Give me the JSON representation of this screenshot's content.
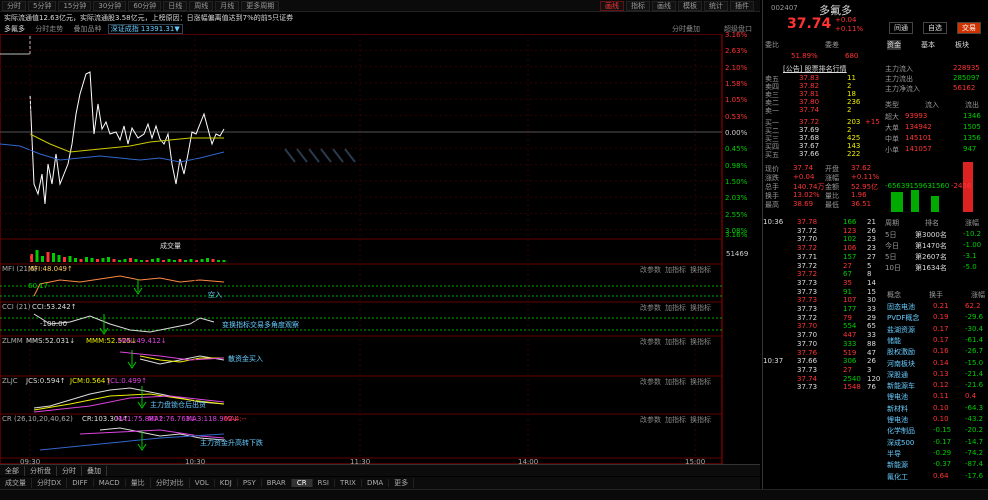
{
  "toolbar": {
    "left": [
      "分时",
      "5分钟",
      "15分钟",
      "30分钟",
      "60分钟",
      "日线",
      "周线",
      "月线",
      "更多周期"
    ],
    "right": [
      "画线",
      "指标",
      "画线",
      "模板",
      "统计",
      "插件"
    ],
    "active_right": 0
  },
  "info_line": "实际流通值12.63亿元，实际流通股3.58亿元，上榜原因：日涨幅偏离值达到7%的前5只证券",
  "chart_header": {
    "name": "多氟多",
    "tab": "分时走势",
    "sub": "叠加品种",
    "index": "深证成指 13391.31▼",
    "right": [
      "分时叠加",
      "超级盘口"
    ]
  },
  "pct_labels": [
    "3.16%",
    "2.63%",
    "2.10%",
    "1.58%",
    "1.05%",
    "0.53%",
    "0.00%",
    "0.45%",
    "0.98%",
    "1.50%",
    "2.03%",
    "2.55%",
    "3.08%",
    "3.16%"
  ],
  "vol": {
    "label": "成交量",
    "right": "51469"
  },
  "mfi": {
    "header": "MFI (21,5)",
    "val": "MFI:48.049↑",
    "note": "空入",
    "sub": "60.17"
  },
  "cci": {
    "header": "CCI (21)",
    "val": "CCI:53.242↑",
    "note": "变换指标交易多角度观察",
    "sub": "-100.00",
    "sub2": "100.00"
  },
  "zlmm": {
    "header": "ZLMM",
    "v1": "MMS:52.031↓",
    "v2": "MMM:52.525↓",
    "v3": "MML:49.412↓",
    "note": "散资金买入"
  },
  "zljc": {
    "header": "ZLJC",
    "v1": "JCS:0.594↑",
    "v2": "JCM:0.564↑",
    "v3": "JCL:0.499↑",
    "note": "主力盘锁仓后出货"
  },
  "cr": {
    "header": "CR (26,10,20,40,62)",
    "v1": "CR:103.301↑",
    "v2": "MA1:75.887↑",
    "v3": "MA2:76.763↓",
    "v4": "MA3:118.902↓",
    "v5": "MA4:--",
    "note": "主力资金升高转下跌"
  },
  "pane_buttons": [
    "改参数",
    "加指标",
    "换指标"
  ],
  "time_labels": [
    "09:30",
    "10:30",
    "11:30",
    "14:00",
    "15:00"
  ],
  "bottom_tabs": [
    "全部",
    "分析盘",
    "分时",
    "叠加"
  ],
  "ind_tabs": [
    "成交量",
    "分时DX",
    "DIFF",
    "MACD",
    "量比",
    "分时对比",
    "VOL",
    "KDJ",
    "PSY",
    "BRAR",
    "CR",
    "RSI",
    "TRIX",
    "DMA",
    "更多"
  ],
  "right_panel": {
    "code": "002407",
    "name": "多氟多",
    "price": "37.74",
    "chg": "+0.04",
    "pct": "+0.11%",
    "btns": [
      "间通",
      "自选",
      "交易"
    ],
    "weibi_label": "委比",
    "weibi": "51.89%",
    "weicha_label": "委差",
    "weicha": "680",
    "tabs": [
      "资金",
      "基本",
      "板块"
    ],
    "notice": "[公告] 股票排名行情",
    "asks": [
      [
        "卖五",
        "37.83",
        "11"
      ],
      [
        "卖四",
        "37.82",
        "2"
      ],
      [
        "卖三",
        "37.81",
        "18"
      ],
      [
        "卖二",
        "37.80",
        "236"
      ],
      [
        "卖一",
        "37.74",
        "2"
      ]
    ],
    "bids": [
      [
        "买一",
        "37.72",
        "203"
      ],
      [
        "买二",
        "37.69",
        "2"
      ],
      [
        "买三",
        "37.68",
        "425"
      ],
      [
        "买四",
        "37.67",
        "143"
      ],
      [
        "买五",
        "37.66",
        "222"
      ]
    ],
    "bid1_extra": "+15",
    "flow": [
      [
        "主力流入",
        "228935"
      ],
      [
        "主力流出",
        "285097"
      ],
      [
        "主力净流入",
        "56162"
      ]
    ],
    "flow_head": [
      "类型",
      "流入",
      "流出"
    ],
    "flow_rows": [
      [
        "超大",
        "93993",
        "1346"
      ],
      [
        "大单",
        "134942",
        "1505"
      ],
      [
        "中单",
        "145101",
        "1356"
      ],
      [
        "小单",
        "141057",
        "947"
      ]
    ],
    "bar_vals": [
      "-65639",
      "-15963",
      "-1560",
      "-2456"
    ],
    "quote": [
      [
        "现价",
        "37.74",
        "开盘",
        "37.62"
      ],
      [
        "涨跌",
        "+0.04",
        "涨幅",
        "+0.11%"
      ],
      [
        "总手",
        "140.74万",
        "金额",
        "52.95亿"
      ],
      [
        "换手",
        "13.02%",
        "量比",
        "1.96"
      ],
      [
        "最高",
        "38.69",
        "最低",
        "36.51"
      ]
    ],
    "ticks": [
      [
        "10:36",
        "37.78",
        "166",
        "21"
      ],
      [
        "",
        "37.72",
        "123",
        "26"
      ],
      [
        "",
        "37.70",
        "102",
        "23"
      ],
      [
        "",
        "37.72",
        "106",
        "23"
      ],
      [
        "",
        "37.71",
        "157",
        "27"
      ],
      [
        "",
        "37.72",
        "27",
        "5"
      ],
      [
        "",
        "37.72",
        "67",
        "8"
      ],
      [
        "",
        "37.73",
        "35",
        "14"
      ],
      [
        "",
        "37.73",
        "91",
        "15"
      ],
      [
        "",
        "37.73",
        "107",
        "30"
      ],
      [
        "",
        "37.73",
        "177",
        "33"
      ],
      [
        "",
        "37.72",
        "79",
        "29"
      ],
      [
        "",
        "37.70",
        "554",
        "65"
      ],
      [
        "",
        "37.70",
        "447",
        "33"
      ],
      [
        "",
        "37.70",
        "333",
        "88"
      ],
      [
        "",
        "37.76",
        "519",
        "47"
      ],
      [
        "10:37",
        "37.66",
        "306",
        "26"
      ],
      [
        "",
        "37.73",
        "27",
        "3"
      ],
      [
        "",
        "37.74",
        "2540",
        "120"
      ],
      [
        "",
        "37.73",
        "1548",
        "76"
      ]
    ],
    "period_head": [
      "周期",
      "排名",
      "涨幅"
    ],
    "periods": [
      [
        "5日",
        "第3000名",
        "-10.2"
      ],
      [
        "今日",
        "第1470名",
        "-1.00"
      ],
      [
        "5日",
        "第2607名",
        "-3.1"
      ],
      [
        "10日",
        "第1634名",
        "-5.0"
      ]
    ],
    "sector_head": [
      "概念",
      "换手",
      "涨幅"
    ],
    "sectors": [
      [
        "固态电池",
        "0.21",
        "62.2"
      ],
      [
        "PVDF概念",
        "0.19",
        "-29.6"
      ],
      [
        "盐湖资源",
        "0.17",
        "-30.4"
      ],
      [
        "储能",
        "0.17",
        "-61.4"
      ],
      [
        "股权激励",
        "0.16",
        "-26.7"
      ],
      [
        "河南板块",
        "0.14",
        "-15.0"
      ],
      [
        "深股通",
        "0.13",
        "-21.4"
      ],
      [
        "新能源车",
        "0.12",
        "-21.6"
      ],
      [
        "锂电池",
        "0.11",
        "0.4"
      ],
      [
        "新材料",
        "0.10",
        "-64.3"
      ],
      [
        "锂电池",
        "0.10",
        "-43.2"
      ],
      [
        "化学制品",
        "-0.15",
        "-20.2"
      ],
      [
        "深成500",
        "-0.17",
        "-14.7"
      ],
      [
        "半导",
        "-0.29",
        "-74.2"
      ],
      [
        "新能源",
        "-0.37",
        "-87.4"
      ],
      [
        "氟化工",
        "0.64",
        "-17.6"
      ]
    ]
  }
}
